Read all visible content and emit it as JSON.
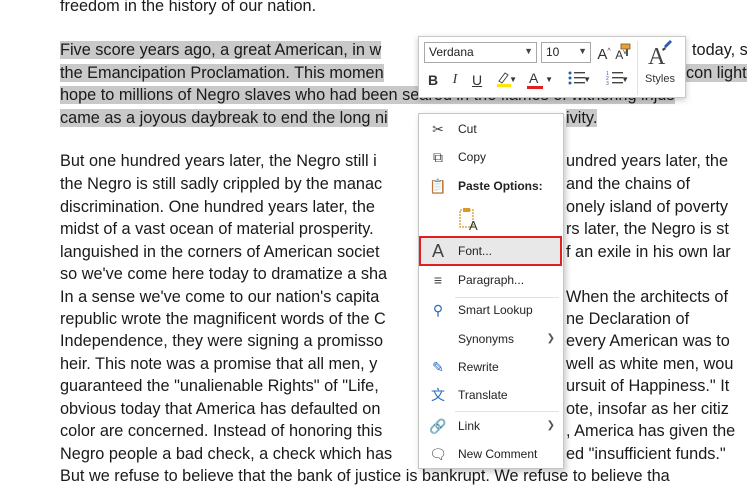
{
  "document": {
    "lines": [
      {
        "pre": "freedom in the history of our nation.",
        "hl": "",
        "post": ""
      },
      {
        "pre": "",
        "hl": "Five score years ago, a great American, in w",
        "post": ""
      },
      {
        "pre": "",
        "hl": "the Emancipation Proclamation. This momen",
        "post": ""
      },
      {
        "pre": "",
        "hl": "hope to millions of Negro slaves who had been seared in the flames of withering injus",
        "post": ""
      },
      {
        "pre": "",
        "hl": "came as a joyous daybreak to end the long ni",
        "post": ""
      },
      {
        "pre": "But one hundred years later, the Negro still i",
        "hl": "",
        "post": ""
      },
      {
        "pre": "the Negro is still sadly crippled by the manac",
        "hl": "",
        "post": ""
      },
      {
        "pre": "discrimination. One hundred years later, the",
        "hl": "",
        "post": ""
      },
      {
        "pre": "midst of a vast ocean of material prosperity.",
        "hl": "",
        "post": ""
      },
      {
        "pre": "languished in the corners of American societ",
        "hl": "",
        "post": ""
      },
      {
        "pre": "so we've come here today to dramatize a sha",
        "hl": "",
        "post": ""
      },
      {
        "pre": "In a sense we've come to our nation's capita",
        "hl": "",
        "post": ""
      },
      {
        "pre": "republic wrote the magnificent words of the C",
        "hl": "",
        "post": ""
      },
      {
        "pre": "Independence, they were signing a promisso",
        "hl": "",
        "post": ""
      },
      {
        "pre": "heir. This note was a promise that all men, y",
        "hl": "",
        "post": ""
      },
      {
        "pre": "guaranteed the \"unalienable Rights\" of \"Life,",
        "hl": "",
        "post": ""
      },
      {
        "pre": "obvious today that America has defaulted on",
        "hl": "",
        "post": ""
      },
      {
        "pre": "color are concerned. Instead of honoring this",
        "hl": "",
        "post": ""
      },
      {
        "pre": "Negro people a bad check, a check which has",
        "hl": "",
        "post": ""
      },
      {
        "pre": "But we refuse to believe that the bank of justice is bankrupt. We refuse to believe tha",
        "hl": "",
        "post": ""
      },
      {
        "pre": "",
        "hl": "",
        "post": ""
      }
    ],
    "right_fragments": [
      {
        "text": "today, s",
        "line": 1
      },
      {
        "text": "con light",
        "line": 2
      },
      {
        "text": "ivity.",
        "line": 4
      },
      {
        "text": "undred years later, the",
        "line": 5
      },
      {
        "text": "and the chains of",
        "line": 6
      },
      {
        "text": "onely island of poverty",
        "line": 7
      },
      {
        "text": "rs later, the Negro is st",
        "line": 8
      },
      {
        "text": "f an exile in his own lar",
        "line": 9
      },
      {
        "text": "When the architects of",
        "line": 11
      },
      {
        "text": "ne Declaration of",
        "line": 12
      },
      {
        "text": "every American was to",
        "line": 13
      },
      {
        "text": "well as white men, wou",
        "line": 14
      },
      {
        "text": "ursuit of Happiness.\" It",
        "line": 15
      },
      {
        "text": "ote, insofar as her citiz",
        "line": 16
      },
      {
        "text": ", America has given the",
        "line": 17
      },
      {
        "text": "ed \"insufficient funds.\"",
        "line": 18
      }
    ]
  },
  "mini_toolbar": {
    "font_name": "Verdana",
    "font_size": "10",
    "grow_font": "A",
    "shrink_font": "A",
    "bold": "B",
    "italic": "I",
    "underline": "U",
    "font_color": "A",
    "styles_label": "Styles",
    "accent_red": "#e02020",
    "highlight_yellow": "#ffe600"
  },
  "context_menu": {
    "items": [
      {
        "label": "Cut",
        "icon": "scissors-icon"
      },
      {
        "label": "Copy",
        "icon": "copy-icon"
      },
      {
        "label": "Paste Options:",
        "icon": "clipboard-icon"
      },
      {
        "label": "Font...",
        "icon": "font-icon"
      },
      {
        "label": "Paragraph...",
        "icon": "paragraph-icon"
      },
      {
        "label": "Smart Lookup",
        "icon": "search-icon"
      },
      {
        "label": "Synonyms",
        "icon": ""
      },
      {
        "label": "Rewrite",
        "icon": "rewrite-icon"
      },
      {
        "label": "Translate",
        "icon": "translate-icon"
      },
      {
        "label": "Link",
        "icon": "link-icon"
      },
      {
        "label": "New Comment",
        "icon": "comment-icon"
      }
    ],
    "highlight_color": "#e02020"
  }
}
